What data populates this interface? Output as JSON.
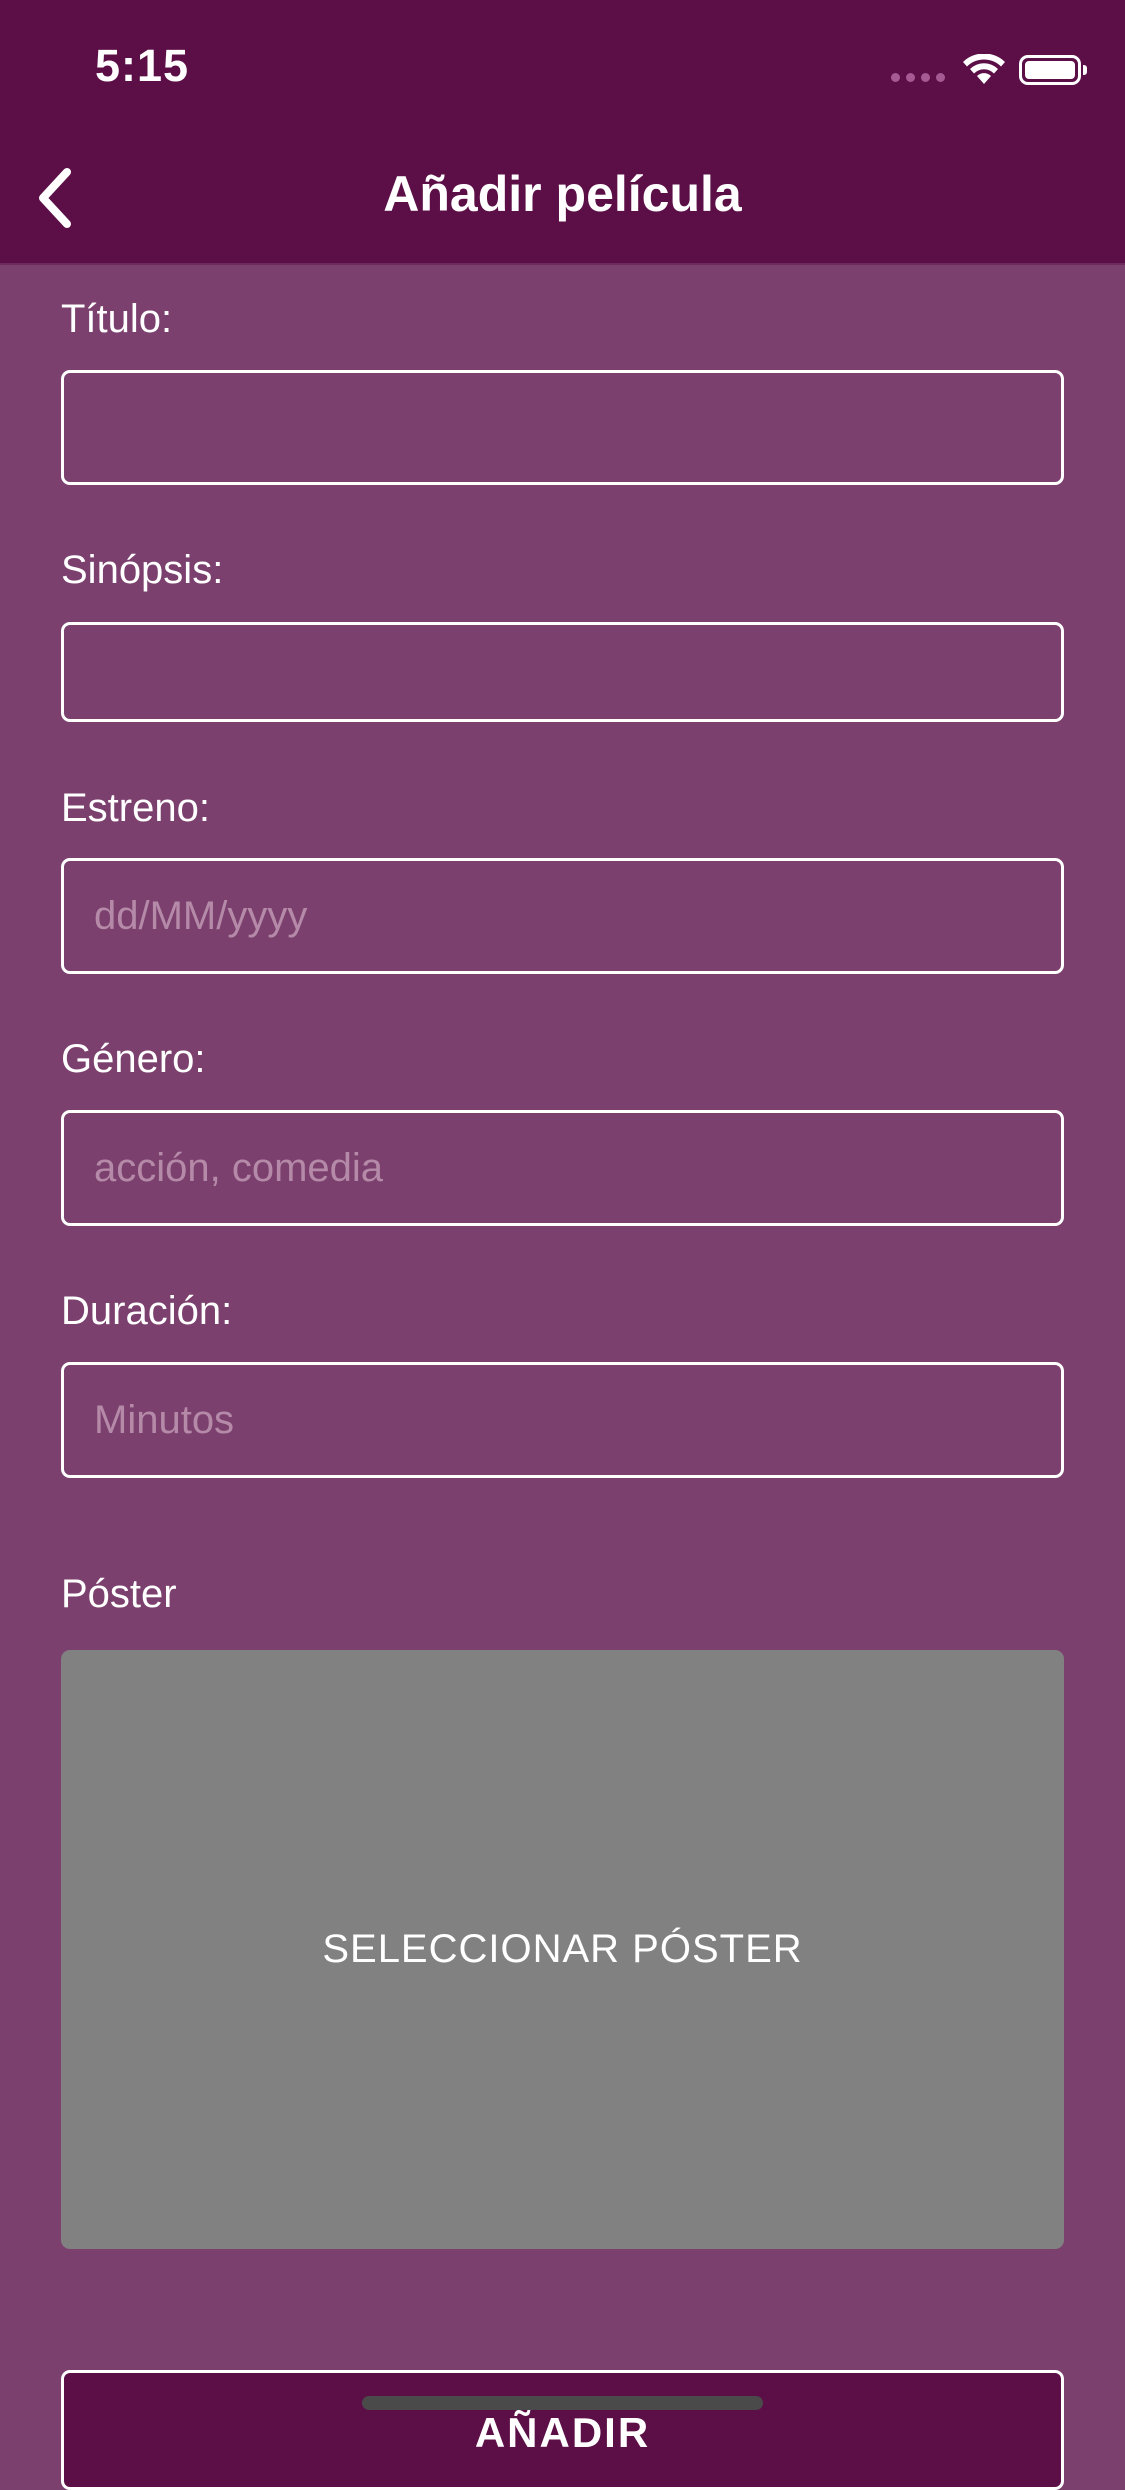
{
  "status_bar": {
    "time": "5:15"
  },
  "nav": {
    "title": "Añadir película",
    "back_icon": "chevron-left-icon"
  },
  "form": {
    "title_label": "Título:",
    "title_value": "",
    "title_placeholder": "",
    "synopsis_label": "Sinópsis:",
    "synopsis_value": "",
    "synopsis_placeholder": "",
    "release_label": "Estreno:",
    "release_value": "",
    "release_placeholder": "dd/MM/yyyy",
    "genre_label": "Género:",
    "genre_value": "",
    "genre_placeholder": "acción, comedia",
    "duration_label": "Duración:",
    "duration_value": "",
    "duration_placeholder": "Minutos",
    "poster_label": "Póster",
    "poster_button": "SELECCIONAR PÓSTER",
    "submit_button": "AÑADIR"
  },
  "colors": {
    "header_bg": "#5c0f47",
    "page_bg": "#7c406e",
    "poster_bg": "#818181",
    "placeholder": "#b58aa8"
  }
}
